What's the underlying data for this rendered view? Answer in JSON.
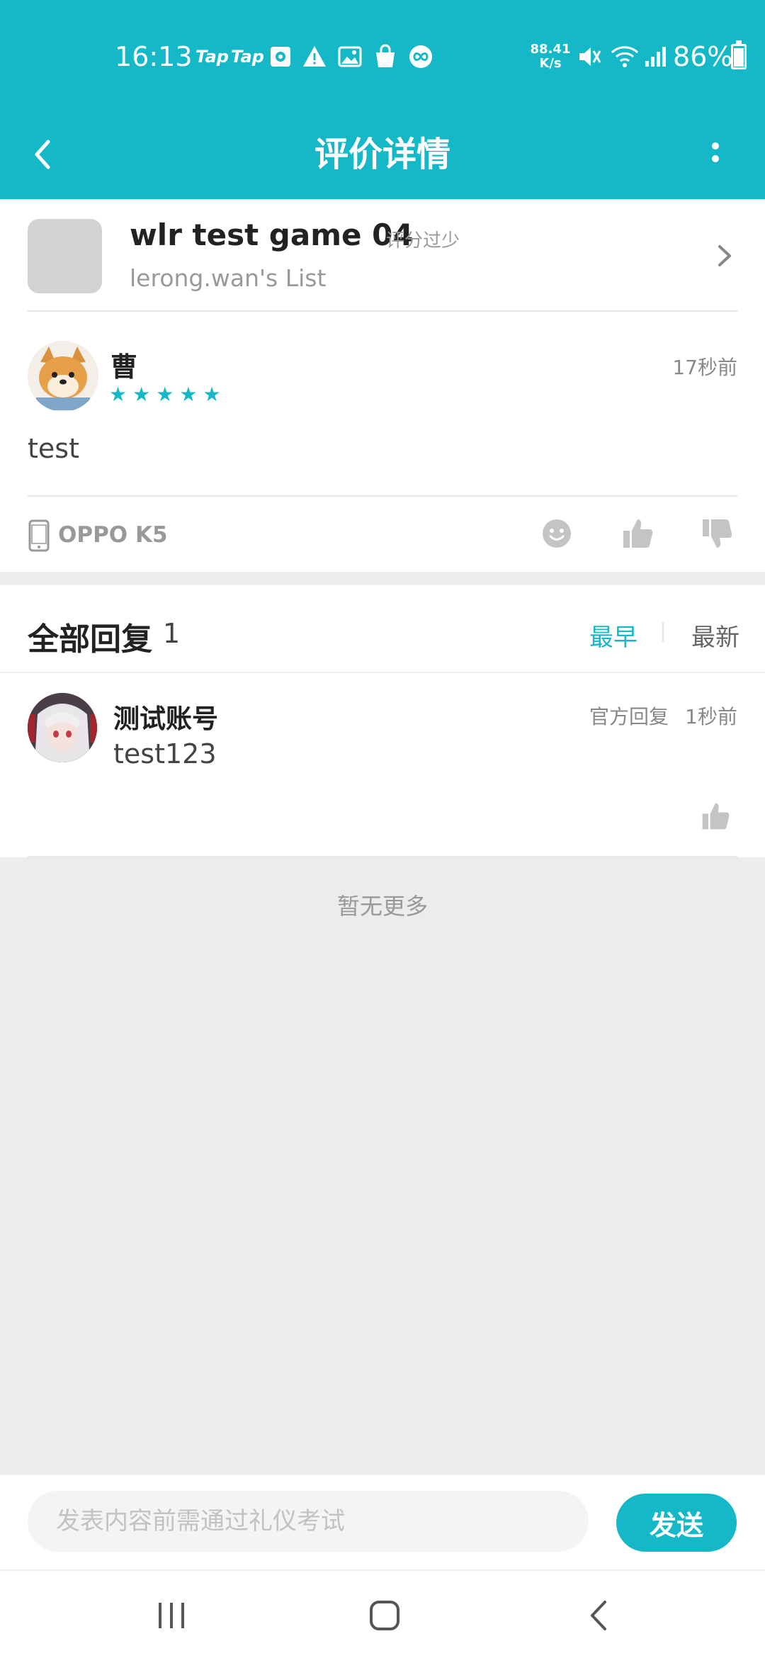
{
  "status_bar": {
    "time": "16:13",
    "tap1": "Tap",
    "tap2": "Tap",
    "speed_top": "88.41",
    "speed_unit": "K/s",
    "battery": "86%",
    "battery_level": 0.86
  },
  "app_bar": {
    "title": "评价详情"
  },
  "game": {
    "title": "wlr test game 04",
    "score_note": "评分过少",
    "list": "lerong.wan's List"
  },
  "review": {
    "author": "曹",
    "stars": 5,
    "time": "17秒前",
    "text": "test",
    "device": "OPPO K5"
  },
  "replies": {
    "title": "全部回复",
    "count": "1",
    "sort_earliest": "最早",
    "sort_newest": "最新",
    "items": [
      {
        "author": "测试账号",
        "badge": "官方回复",
        "time": "1秒前",
        "text": "test123"
      }
    ],
    "no_more": "暂无更多"
  },
  "composer": {
    "placeholder": "发表内容前需通过礼仪考试",
    "send_label": "发送"
  },
  "colors": {
    "accent": "#15b8c7",
    "background": "#ececec"
  }
}
